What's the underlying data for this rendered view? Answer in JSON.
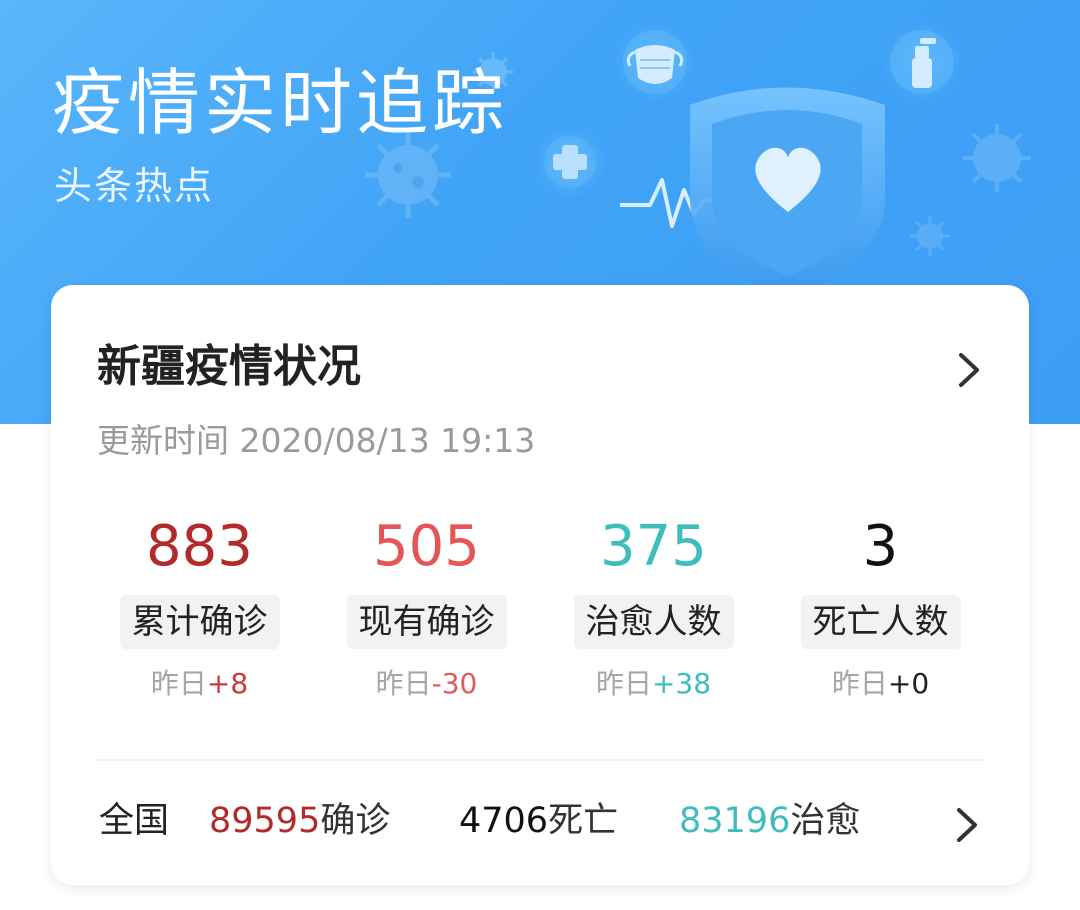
{
  "header": {
    "title": "疫情实时追踪",
    "subtitle": "头条热点"
  },
  "card": {
    "title": "新疆疫情状况",
    "update_time": "更新时间 2020/08/13 19:13",
    "stats": [
      {
        "value": "883",
        "label": "累计确诊",
        "delta_prefix": "昨日",
        "delta": "+8",
        "value_color": "#b22a2a",
        "delta_color": "#c93a3a"
      },
      {
        "value": "505",
        "label": "现有确诊",
        "delta_prefix": "昨日",
        "delta": "-30",
        "value_color": "#e45555",
        "delta_color": "#e35a5a"
      },
      {
        "value": "375",
        "label": "治愈人数",
        "delta_prefix": "昨日",
        "delta": "+38",
        "value_color": "#3fbcbc",
        "delta_color": "#3fbcbc"
      },
      {
        "value": "3",
        "label": "死亡人数",
        "delta_prefix": "昨日",
        "delta": "+0",
        "value_color": "#111111",
        "delta_color": "#222222"
      }
    ],
    "national": {
      "label": "全国",
      "confirmed_value": "89595",
      "confirmed_unit": "确诊",
      "deaths_value": "4706",
      "deaths_unit": "死亡",
      "cured_value": "83196",
      "cured_unit": "治愈",
      "confirmed_color": "#b22a2a",
      "deaths_color": "#111111",
      "cured_color": "#3fbcbc"
    }
  },
  "icons": {
    "hero": [
      "virus-icon",
      "plus-icon",
      "mask-icon",
      "spray-bottle-icon",
      "shield-heart-icon",
      "heartbeat-line-icon"
    ],
    "chevron": "chevron-right-icon"
  }
}
